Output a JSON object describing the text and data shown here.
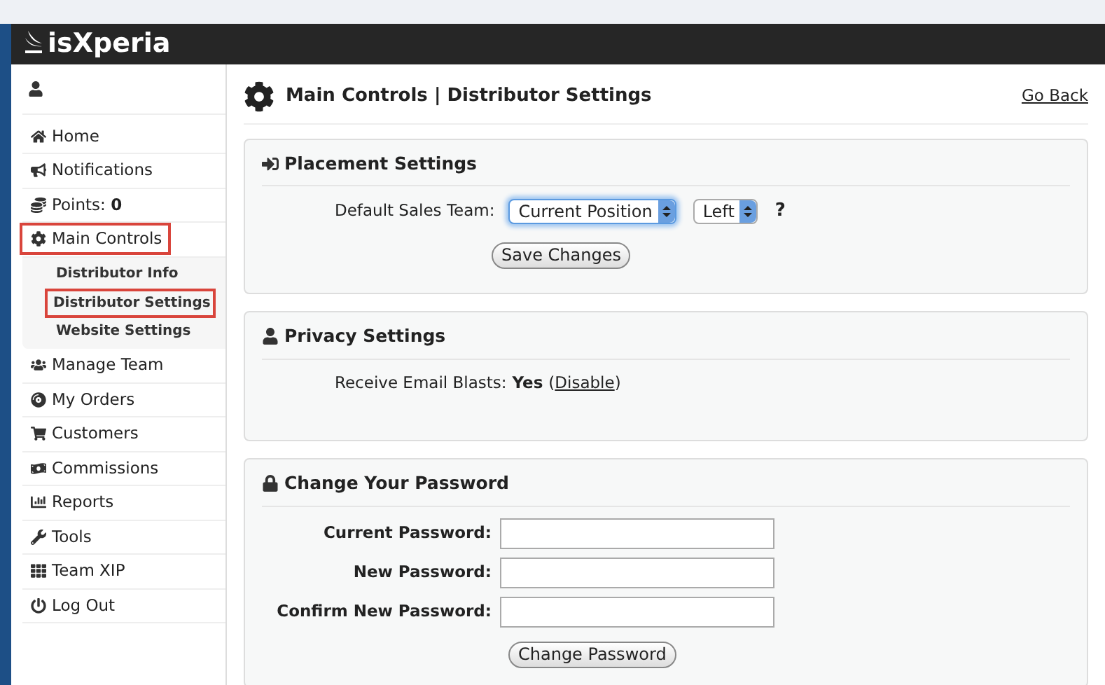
{
  "logo": "isXperia",
  "sidebar": {
    "items": [
      {
        "label": "Home",
        "highlighted": false
      },
      {
        "label": "Notifications",
        "highlighted": false
      },
      {
        "label": "Points: **0**",
        "highlighted": false
      },
      {
        "label": "Main Controls",
        "highlighted": true,
        "children": [
          {
            "label": "Distributor Info",
            "highlighted": false
          },
          {
            "label": "Distributor Settings",
            "highlighted": true
          },
          {
            "label": "Website Settings",
            "highlighted": false
          }
        ]
      },
      {
        "label": "Manage Team",
        "highlighted": false
      },
      {
        "label": "My Orders",
        "highlighted": false
      },
      {
        "label": "Customers",
        "highlighted": false
      },
      {
        "label": "Commissions",
        "highlighted": false
      },
      {
        "label": "Reports",
        "highlighted": false
      },
      {
        "label": "Tools",
        "highlighted": false
      },
      {
        "label": "Team XIP",
        "highlighted": false
      },
      {
        "label": "Log Out",
        "highlighted": false
      }
    ]
  },
  "page": {
    "title": "Main Controls | Distributor Settings",
    "back_link": "Go Back"
  },
  "placement": {
    "title": "Placement Settings",
    "label": "Default Sales Team:",
    "selects": [
      {
        "value": "Current Position",
        "focused": true
      },
      {
        "value": "Left",
        "focused": false
      }
    ],
    "help": "?",
    "button": "Save Changes"
  },
  "privacy": {
    "title": "Privacy Settings",
    "label": "Receive Email Blasts:",
    "value": "Yes",
    "link_open": "(",
    "link": "Disable",
    "link_close": ")"
  },
  "password": {
    "title": "Change Your Password",
    "fields": [
      {
        "label": "Current Password:"
      },
      {
        "label": "New Password:"
      },
      {
        "label": "Confirm New Password:"
      }
    ],
    "button": "Change Password"
  }
}
